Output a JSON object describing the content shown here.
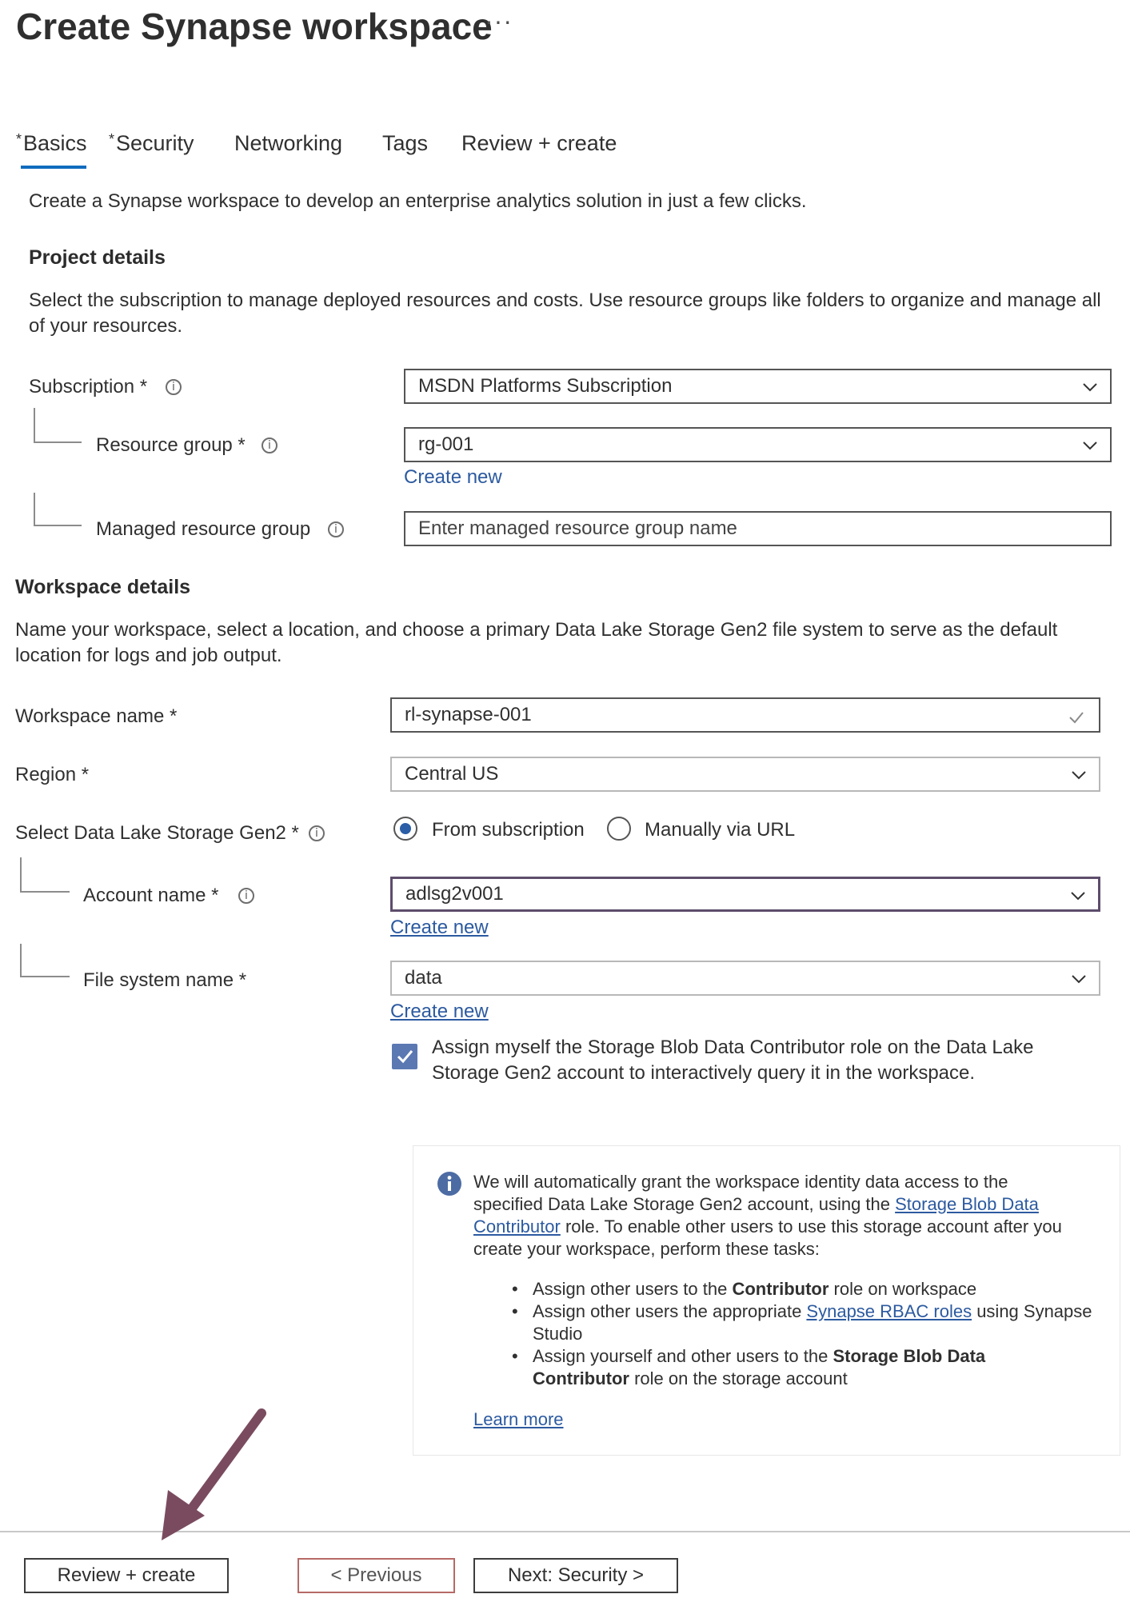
{
  "header": {
    "title": "Create Synapse workspace",
    "more_label": "···"
  },
  "tabs": [
    {
      "label": "Basics",
      "required": "*"
    },
    {
      "label": "Security",
      "required": "*"
    },
    {
      "label": "Networking"
    },
    {
      "label": "Tags"
    },
    {
      "label": "Review + create"
    }
  ],
  "intro": "Create a Synapse workspace to develop an enterprise analytics solution in just a few clicks.",
  "project": {
    "title": "Project details",
    "description": "Select the subscription to manage deployed resources and costs. Use resource groups like folders to organize and manage all of your resources.",
    "subscription": {
      "label": "Subscription *",
      "value": "MSDN Platforms Subscription"
    },
    "resource_group": {
      "label": "Resource group *",
      "value": "rg-001",
      "create_new": "Create new"
    },
    "managed_resource_group": {
      "label": "Managed resource group",
      "placeholder": "Enter managed resource group name"
    }
  },
  "workspace": {
    "title": "Workspace details",
    "description": "Name your workspace, select a location, and choose a primary Data Lake Storage Gen2 file system to serve as the default location for logs and job output.",
    "name": {
      "label": "Workspace name *",
      "value": "rl-synapse-001"
    },
    "region": {
      "label": "Region *",
      "value": "Central US"
    },
    "storage": {
      "label": "Select Data Lake Storage Gen2 *",
      "option_subscription": "From subscription",
      "option_url": "Manually via URL",
      "selected": "From subscription"
    },
    "account": {
      "label": "Account name *",
      "value": "adlsg2v001",
      "create_new": "Create new"
    },
    "file_system": {
      "label": "File system name *",
      "value": "data",
      "create_new": "Create new"
    },
    "assign_role": {
      "checked": true,
      "label": "Assign myself the Storage Blob Data Contributor role on the Data Lake Storage Gen2 account to interactively query it in the workspace."
    }
  },
  "callout": {
    "line1": "We will automatically grant the workspace identity data access to the",
    "line2_prefix": "specified Data Lake Storage Gen2 account, using the ",
    "line2_link": "Storage Blob Data",
    "line3_link": "Contributor",
    "line3_suffix": " role. To enable other users to use this storage account after you",
    "line4": "create your workspace, perform these tasks:",
    "bullets": [
      {
        "prefix": "Assign other users to the ",
        "bold": "Contributor",
        "suffix": " role on workspace"
      },
      {
        "prefix": "Assign other users the appropriate ",
        "link": "Synapse RBAC roles",
        "suffix": " using Synapse",
        "line2": "Studio"
      },
      {
        "prefix": "Assign yourself and other users to the ",
        "bold": "Storage Blob Data",
        "bold2": "Contributor",
        "suffix2": " role on the storage account"
      }
    ],
    "learn_more": "Learn more"
  },
  "footer": {
    "review_create": "Review + create",
    "previous": "< Previous",
    "next": "Next: Security >"
  },
  "colors": {
    "accent": "#0f6cbd",
    "link": "#2c5aa0",
    "arrow": "#7a4b5f",
    "checkbox": "#5b78b3"
  }
}
